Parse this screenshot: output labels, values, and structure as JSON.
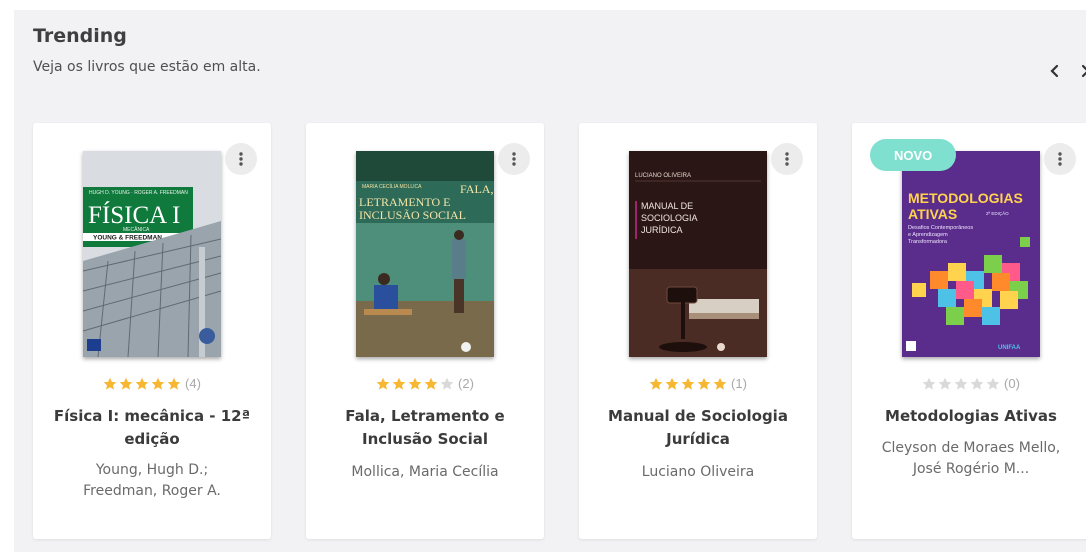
{
  "section": {
    "title": "Trending",
    "subtitle": "Veja os livros que estão em alta."
  },
  "colors": {
    "star_filled": "#f7b733",
    "star_empty": "#d9d9d9",
    "badge": "#7fe0d0",
    "panel_bg": "#f2f2f4"
  },
  "books": [
    {
      "title_line1": "Física I: mecânica - 12ª",
      "title_line2": "edição",
      "author_line1": "Young, Hugh D.;",
      "author_line2": "Freedman, Roger A.",
      "rating": 5,
      "rating_count": "(4)",
      "cover": {
        "title": "FÍSICA I",
        "subtitle": "MECÂNICA",
        "authors": "YOUNG & FREEDMAN",
        "edition": "12ª EDIÇÃO",
        "top": "HUGH D. YOUNG · ROGER A. FREEDMAN"
      }
    },
    {
      "title_line1": "Fala, Letramento e",
      "title_line2": "Inclusão Social",
      "author_line1": "Mollica, Maria Cecília",
      "author_line2": "",
      "rating": 4,
      "rating_count": "(2)",
      "cover": {
        "author": "MARIA CECÍLIA MOLLICA",
        "title1": "FALA,",
        "title2": "LETRAMENTO E",
        "title3": "INCLUSÃO SOCIAL"
      }
    },
    {
      "title_line1": "Manual de Sociologia",
      "title_line2": "Jurídica",
      "author_line1": "Luciano Oliveira",
      "author_line2": "",
      "rating": 5,
      "rating_count": "(1)",
      "cover": {
        "author": "LUCIANO OLIVEIRA",
        "title1": "MANUAL DE",
        "title2": "SOCIOLOGIA",
        "title3": "JURÍDICA"
      }
    },
    {
      "title_line1": "Metodologias Ativas",
      "title_line2": "",
      "author_line1": "Cleyson de Moraes Mello,",
      "author_line2": "José Rogério M...",
      "rating": 0,
      "rating_count": "(0)",
      "badge": "NOVO",
      "cover": {
        "title1": "METODOLOGIAS",
        "title2": "ATIVAS",
        "edition": "2ª EDIÇÃO",
        "desc1": "Desafios Contemporâneos",
        "desc2": "e Aprendizagem",
        "desc3": "Transformadora",
        "publisher": "UNIFAA"
      }
    }
  ]
}
